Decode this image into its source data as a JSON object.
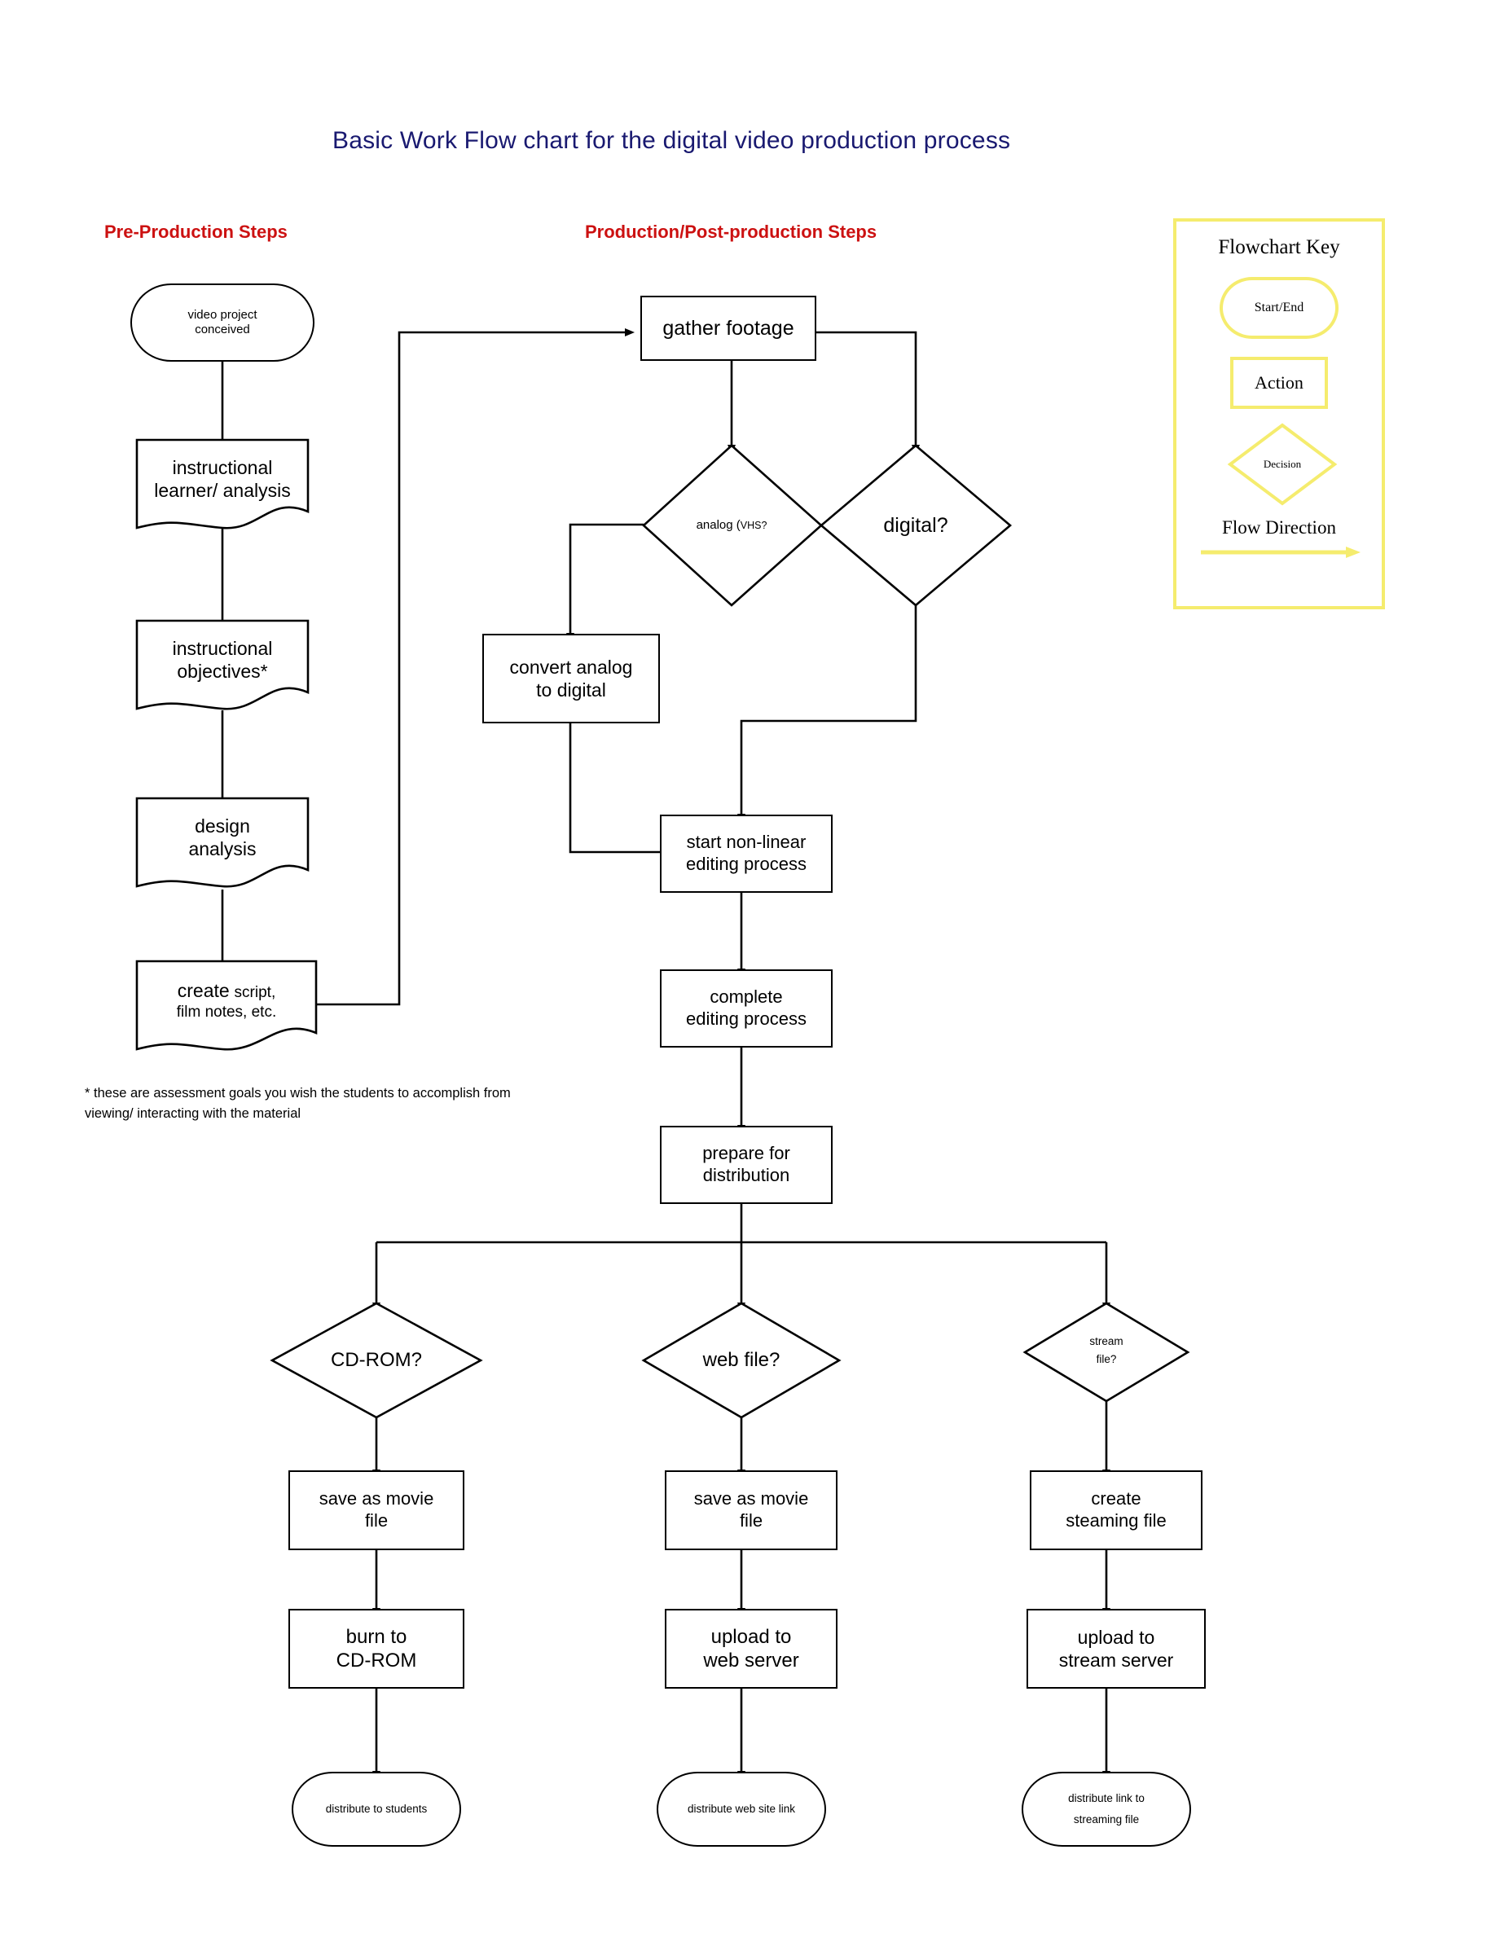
{
  "title": "Basic Work Flow chart for the digital video production process",
  "columns": {
    "left_header": "Pre-Production Steps",
    "right_header": "Production/Post-production Steps"
  },
  "footnote": "* these are assessment goals you wish the students to accomplish from viewing/ interacting with the material",
  "key": {
    "title": "Flowchart Key",
    "start_end": "Start/End",
    "action": "Action",
    "decision": "Decision",
    "flow_direction": "Flow Direction",
    "border_color": "#f5ec6e"
  },
  "nodes": {
    "video_project": {
      "line1": "video project",
      "line2": "conceived",
      "shape": "terminator"
    },
    "instr_learner": {
      "line1": "instructional",
      "line2": "learner/ analysis",
      "shape": "document"
    },
    "instr_objectives": {
      "line1": "instructional",
      "line2": "objectives*",
      "shape": "document"
    },
    "design_analysis": {
      "line1": "design",
      "line2": "analysis",
      "shape": "document"
    },
    "create_script": {
      "line1a": "create",
      "line1b": "script,",
      "line2": "film notes, etc.",
      "shape": "document"
    },
    "gather_footage": {
      "line1": "gather footage",
      "shape": "process"
    },
    "analog_q": {
      "line1a": "analog (",
      "line1b": "VHS?",
      "shape": "decision"
    },
    "digital_q": {
      "line1": "digital?",
      "shape": "decision"
    },
    "convert": {
      "line1": "convert analog",
      "line2": "to digital",
      "shape": "process"
    },
    "start_edit": {
      "line1": "start non-linear",
      "line2": "editing process",
      "shape": "process"
    },
    "complete_edit": {
      "line1": "complete",
      "line2": "editing process",
      "shape": "process"
    },
    "prepare_dist": {
      "line1": "prepare for",
      "line2": "distribution",
      "shape": "process"
    },
    "cdrom_q": {
      "line1": "CD-ROM?",
      "shape": "decision"
    },
    "webfile_q": {
      "line1": "web file?",
      "shape": "decision"
    },
    "streamfile_q": {
      "line1": "stream",
      "line2": "file?",
      "shape": "decision"
    },
    "save_movie_1": {
      "line1": "save as movie",
      "line2": "file",
      "shape": "process"
    },
    "save_movie_2": {
      "line1": "save as movie",
      "line2": "file",
      "shape": "process"
    },
    "create_stream": {
      "line1": "create",
      "line2": "steaming file",
      "shape": "process"
    },
    "burn_cd": {
      "line1": "burn to",
      "line2": "CD-ROM",
      "shape": "process"
    },
    "upload_web": {
      "line1": "upload to",
      "line2": "web server",
      "shape": "process"
    },
    "upload_stream": {
      "line1": "upload to",
      "line2": "stream server",
      "shape": "process"
    },
    "dist_students": {
      "line1": "distribute to students",
      "shape": "terminator"
    },
    "dist_website": {
      "line1": "distribute web site link",
      "shape": "terminator"
    },
    "dist_streaming": {
      "line1": "distribute link to",
      "line2": "streaming file",
      "shape": "terminator"
    }
  }
}
